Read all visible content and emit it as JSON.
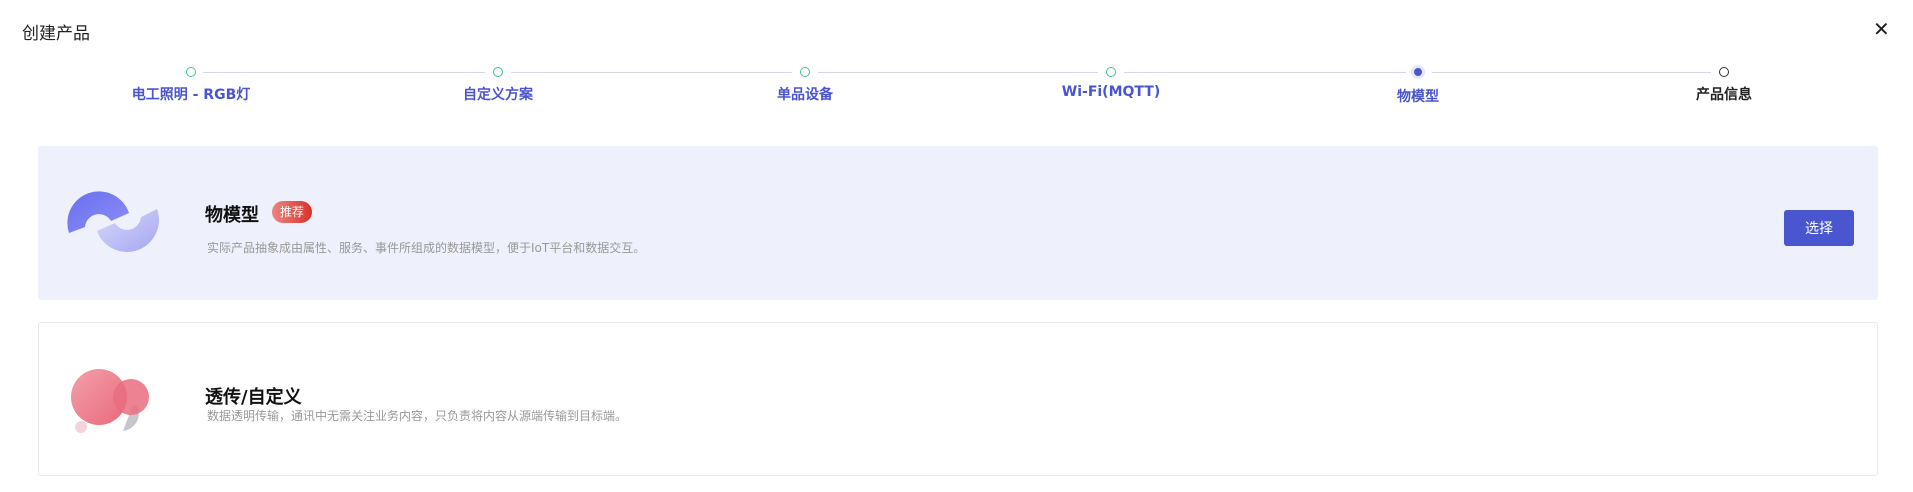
{
  "header": {
    "title": "创建产品",
    "close_icon": "close-icon"
  },
  "steps": [
    {
      "label": "电工照明 - RGB灯",
      "status": "done"
    },
    {
      "label": "自定义方案",
      "status": "done"
    },
    {
      "label": "单品设备",
      "status": "done"
    },
    {
      "label": "Wi-Fi(MQTT)",
      "status": "done"
    },
    {
      "label": "物模型",
      "status": "current"
    },
    {
      "label": "产品信息",
      "status": "todo"
    }
  ],
  "options": [
    {
      "title": "物模型",
      "badge": "推荐",
      "description": "实际产品抽象成由属性、服务、事件所组成的数据模型，便于IoT平台和数据交互。",
      "button": "选择",
      "selected": true
    },
    {
      "title": "透传/自定义",
      "description": "数据透明传输，通讯中无需关注业务内容，只负责将内容从源端传输到目标端。",
      "selected": false
    }
  ],
  "colors": {
    "accent": "#4a55d0",
    "done": "#3ec58c",
    "selected_bg": "#eef0fb",
    "badge": "#d8322b"
  }
}
